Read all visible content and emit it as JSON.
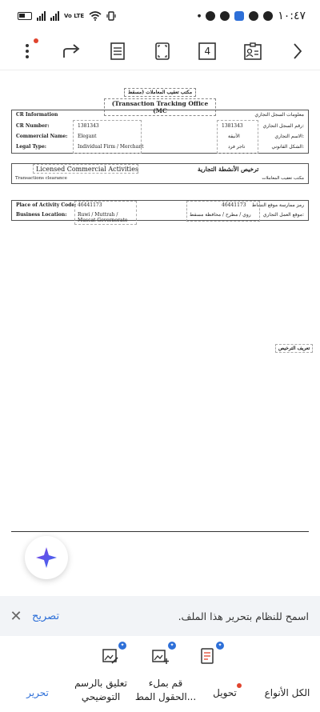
{
  "status_bar": {
    "time": "١٠:٤٧",
    "network": "Vo LTE",
    "battery_icon": "battery-icon"
  },
  "toolbar": {
    "page_number": "4",
    "icons": [
      "more-vert-icon",
      "share-icon",
      "document-icon",
      "crop-icon",
      "page-icon",
      "contact-card-icon",
      "chevron-right-icon"
    ]
  },
  "document": {
    "title_ar": "مكتب تعقيب المعاملات (مسقط",
    "title_en": "(Transaction Tracking Office (MC",
    "cr_section": {
      "header_en": "CR Information",
      "header_ar": "معلومات السجل التجاري",
      "rows": [
        {
          "label_en": "CR Number:",
          "value_en": "1381343",
          "value_ar": "1381343",
          "label_ar": "رقم السجل التجاري:"
        },
        {
          "label_en": "Commercial Name:",
          "value_en": "Elegant",
          "value_ar": "الأنيقة",
          "label_ar": "الاسم التجاري:"
        },
        {
          "label_en": "Legal Type:",
          "value_en": "Individual Firm / Merchant",
          "value_ar": "تاجر فرد",
          "label_ar": "الشكل القانوني:"
        }
      ]
    },
    "license_section": {
      "title_en": "Licensed Commercial Activities",
      "title_ar": "ترخيص الأنشطة التجارية",
      "sub_en": "Transactions clearance",
      "sub_ar": "مكتب تعقيب المعاملات"
    },
    "location_section": {
      "rows": [
        {
          "label_en": "Place of Activity Code:",
          "value_en": "46441173",
          "value_ar": "46441173",
          "label_ar": "رمز ممارسة موقع النشاط"
        },
        {
          "label_en": "Business Location:",
          "value_en": "Ruwi / Muttrah / Muscat Governorate",
          "value_ar": "روي / مطرح / محافظة مسقط",
          "label_ar": "موقع العمل التجاري:"
        }
      ]
    },
    "license_definition_ar": "تعريف الترخيص"
  },
  "banner": {
    "text": "اسمح للنظام بتحرير هذا الملف.",
    "action": "تصريح"
  },
  "tools": [
    "edit-image-icon",
    "add-image-icon",
    "ai-document-icon"
  ],
  "nav": {
    "all_types": "الكل الأنواع",
    "convert": "تحويل",
    "fill_fields_1": "قم بملء",
    "fill_fields_2": "الحقول المط...",
    "comment_1": "تعليق بالرسم",
    "comment_2": "التوضيحي",
    "edit": "تحرير"
  },
  "colors": {
    "accent": "#2d6fd8",
    "notification": "#e0442e",
    "banner_bg": "#f2f4f7"
  }
}
